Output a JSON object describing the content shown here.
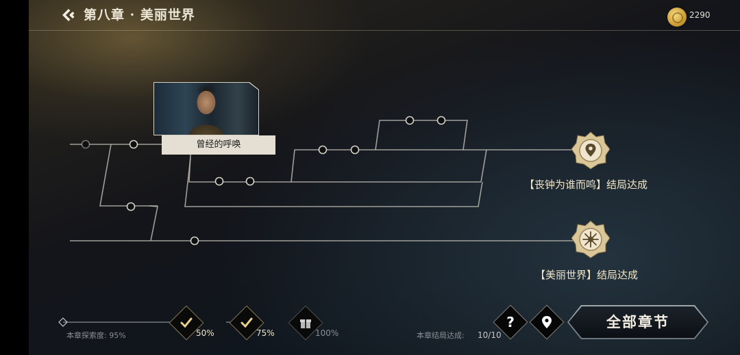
{
  "header": {
    "chapter_title": "第八章 · 美丽世界",
    "coins": "2290",
    "back_icon": "chevron-left-diamond-icon",
    "coin_icon": "gold-coin-icon"
  },
  "story_node": {
    "label": "曾经的呼唤"
  },
  "endings": [
    {
      "label": "【丧钟为谁而鸣】结局达成",
      "icon": "location-pin-emblem-icon"
    },
    {
      "label": "【美丽世界】结局达成",
      "icon": "flower-emblem-icon"
    }
  ],
  "exploration": {
    "label": "本章探索度:",
    "value": "95%",
    "progress": 0.95,
    "milestones": [
      {
        "pct": "50%",
        "icon": "checkmark-icon",
        "reached": true
      },
      {
        "pct": "75%",
        "icon": "checkmark-icon",
        "reached": true
      },
      {
        "pct": "100%",
        "icon": "gift-icon",
        "reached": false
      }
    ]
  },
  "ending_progress": {
    "label": "本章结局达成:",
    "value": "10/10"
  },
  "buttons": {
    "help_icon": "question-icon",
    "help_label": "?",
    "locate_icon": "map-pin-icon",
    "all_chapters": "全部章节"
  },
  "colors": {
    "accent_gold": "#d9b56a",
    "line": "#c8c4b8"
  }
}
